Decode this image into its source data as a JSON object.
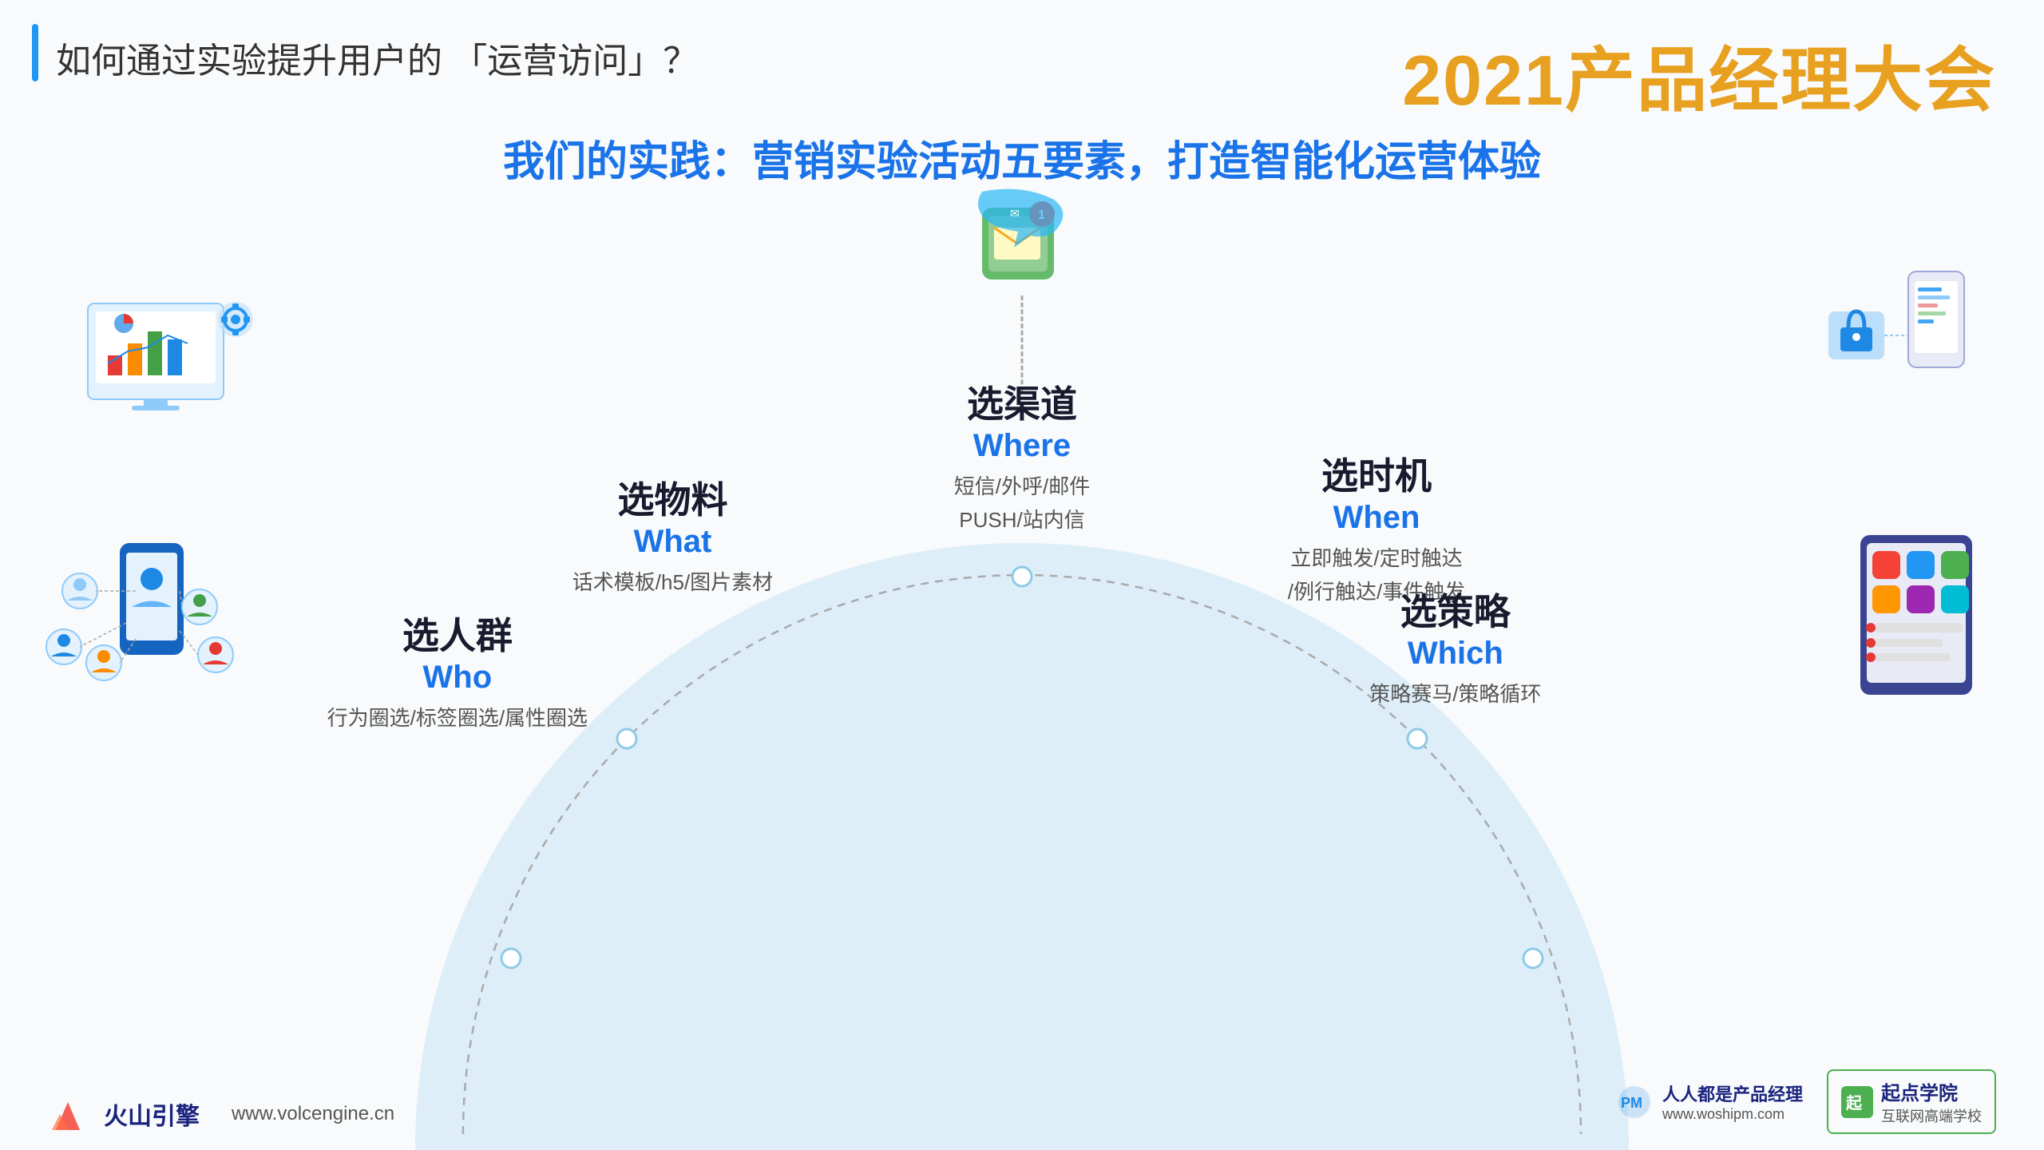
{
  "header": {
    "accent_bar": true,
    "title": "如何通过实验提升用户的 「运营访问」？",
    "brand_title": "2021产品经理大会"
  },
  "main": {
    "subtitle": "我们的实践：营销实验活动五要素，打造智能化运营体验"
  },
  "labels": {
    "where": {
      "cn": "选渠道",
      "en": "Where",
      "desc_line1": "短信/外呼/邮件",
      "desc_line2": "PUSH/站内信"
    },
    "what": {
      "cn": "选物料",
      "en": "What",
      "desc_line1": "话术模板/h5/图片素材"
    },
    "when": {
      "cn": "选时机",
      "en": "When",
      "desc_line1": "立即触发/定时触达",
      "desc_line2": "/例行触达/事件触发"
    },
    "who": {
      "cn": "选人群",
      "en": "Who",
      "desc_line1": "行为圈选/标签圈选/属性圈选"
    },
    "which": {
      "cn": "选策略",
      "en": "Which",
      "desc_line1": "策略赛马/策略循环"
    }
  },
  "footer": {
    "logo_text": "火山引擎",
    "url": "www.volcengine.cn",
    "right_logo1": "人人都是产品经理",
    "right_url1": "www.woshipm.com",
    "right_logo2": "起点学院",
    "right_tagline": "互联网高端学校"
  }
}
